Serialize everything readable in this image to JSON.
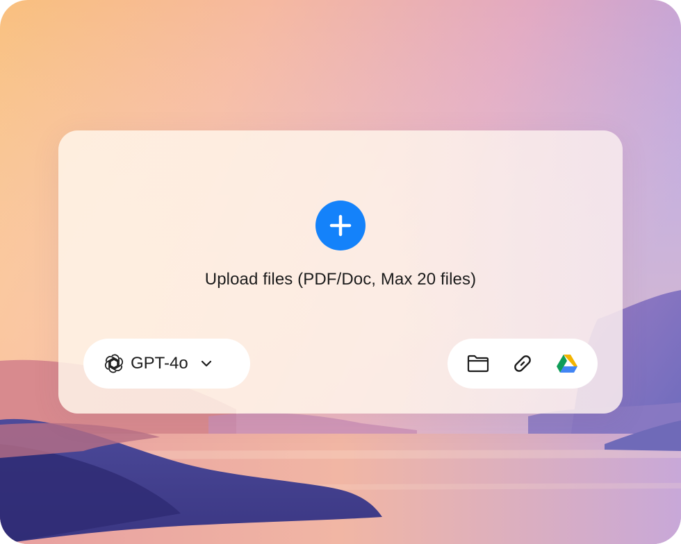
{
  "upload": {
    "text": "Upload files (PDF/Doc, Max 20 files)",
    "icon": "plus-icon"
  },
  "model": {
    "label": "GPT-4o",
    "icon": "openai-logo-icon",
    "dropdown_icon": "chevron-down-icon"
  },
  "sources": [
    {
      "icon": "folder-icon"
    },
    {
      "icon": "link-icon"
    },
    {
      "icon": "google-drive-icon"
    }
  ],
  "colors": {
    "accent": "#1482fa",
    "text": "#1b1b1b",
    "card": "#fff6ec"
  }
}
